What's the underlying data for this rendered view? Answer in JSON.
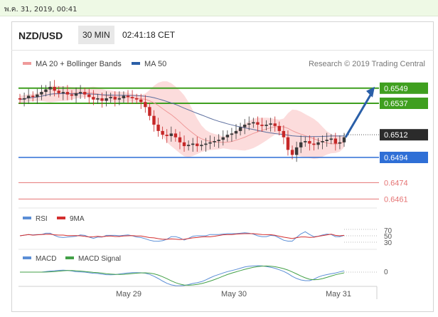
{
  "timestamp_bar": "พ.ค. 31, 2019, 00:41",
  "header": {
    "pair": "NZD/USD",
    "timeframe": "30 MIN",
    "time": "02:41:18 CET"
  },
  "legend": {
    "ma20": "MA 20 + Bollinger Bands",
    "ma50": "MA 50",
    "source": "Research © 2019 Trading Central"
  },
  "colors": {
    "candle_up": "#3a3a3a",
    "candle_down": "#c62828",
    "band_fill": "#fbd0d0",
    "ma20": "#ef9a9a",
    "ma50": "#5c6e9e",
    "resistance": "#3f9f1f",
    "support": "#2f6fd6",
    "target": "#e57373",
    "arrow": "#2a5fa8"
  },
  "chart_data": [
    {
      "type": "line",
      "title": "NZD/USD 30 MIN",
      "x_ticks": [
        "May 29",
        "May 30",
        "May 31"
      ],
      "ylim": [
        0.6452,
        0.6562
      ],
      "levels": [
        {
          "value": "0.6549",
          "kind": "resistance"
        },
        {
          "value": "0.6537",
          "kind": "resistance"
        },
        {
          "value": "0.6512",
          "kind": "current"
        },
        {
          "value": "0.6494",
          "kind": "support"
        },
        {
          "value": "0.6474",
          "kind": "target"
        },
        {
          "value": "0.6461",
          "kind": "target"
        }
      ],
      "series": [
        {
          "name": "MA 20 + Bollinger Bands"
        },
        {
          "name": "MA 50"
        }
      ],
      "close": [
        0.654,
        0.6541,
        0.6543,
        0.6542,
        0.6544,
        0.6546,
        0.6548,
        0.655,
        0.6547,
        0.6545,
        0.6546,
        0.6544,
        0.6543,
        0.6545,
        0.6546,
        0.6544,
        0.6542,
        0.654,
        0.6541,
        0.6539,
        0.6541,
        0.6542,
        0.654,
        0.6541,
        0.6543,
        0.6542,
        0.6541,
        0.654,
        0.6538,
        0.6534,
        0.6527,
        0.652,
        0.6515,
        0.6512,
        0.6511,
        0.6513,
        0.651,
        0.6506,
        0.6503,
        0.6504,
        0.6505,
        0.6503,
        0.6504,
        0.6505,
        0.6506,
        0.6507,
        0.6508,
        0.651,
        0.6512,
        0.6513,
        0.6515,
        0.6518,
        0.652,
        0.6521,
        0.6522,
        0.652,
        0.6519,
        0.652,
        0.6521,
        0.6519,
        0.6515,
        0.651,
        0.65,
        0.6496,
        0.6502,
        0.6506,
        0.6507,
        0.6505,
        0.6504,
        0.6506,
        0.6507,
        0.6508,
        0.6509,
        0.6505,
        0.6506,
        0.651
      ]
    },
    {
      "type": "line",
      "title": "RSI",
      "series": [
        {
          "name": "RSI"
        },
        {
          "name": "9MA"
        }
      ],
      "levels": [
        "70",
        "50",
        "30"
      ]
    },
    {
      "type": "line",
      "title": "MACD",
      "series": [
        {
          "name": "MACD"
        },
        {
          "name": "MACD Signal"
        }
      ],
      "levels": [
        "0"
      ]
    }
  ]
}
